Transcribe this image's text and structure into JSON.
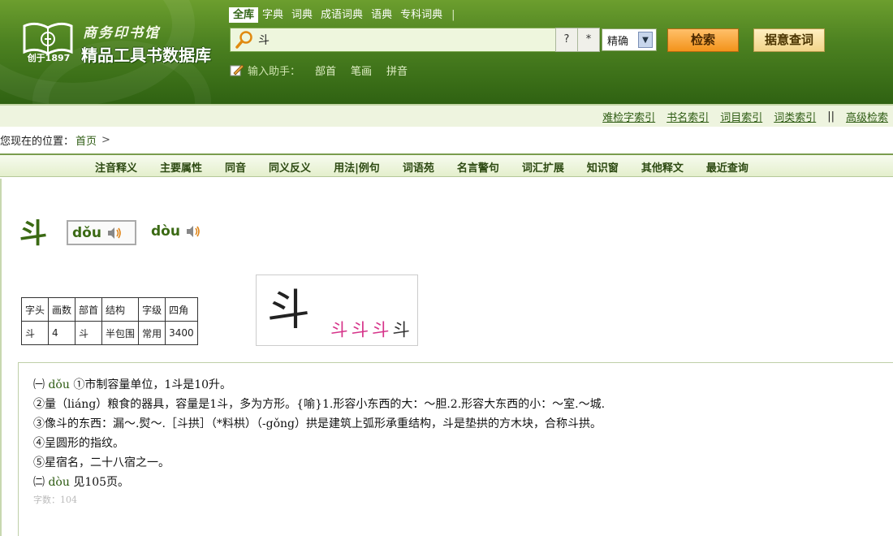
{
  "header": {
    "logo_year": "创于1897",
    "logo_publisher": "商务印书馆",
    "logo_title": "精品工具书数据库"
  },
  "db_tabs": [
    "全库",
    "字典",
    "词典",
    "成语词典",
    "语典",
    "专科词典"
  ],
  "search": {
    "value": "斗",
    "wildcard_q": "?",
    "wildcard_star": "*",
    "mode": "精确",
    "search_label": "检索",
    "meaning_label": "据意查词"
  },
  "assist": {
    "label": "输入助手：",
    "links": [
      "部首",
      "笔画",
      "拼音"
    ]
  },
  "index_links": [
    "难检字索引",
    "书名索引",
    "词目索引",
    "词类索引",
    "高级检索"
  ],
  "breadcrumb": {
    "label": "您现在的位置：",
    "home": "首页",
    "sep": ">"
  },
  "section_nav": [
    "注音释义",
    "主要属性",
    "同音",
    "同义反义",
    "用法|例句",
    "词语苑",
    "名言警句",
    "词汇扩展",
    "知识窗",
    "其他释文",
    "最近查询"
  ],
  "entry": {
    "character": "斗",
    "pinyin1": "dǒu",
    "pinyin2": "dòu",
    "table_headers": [
      "字头",
      "画数",
      "部首",
      "结构",
      "字级",
      "四角"
    ],
    "table_values": [
      "斗",
      "4",
      "斗",
      "半包围",
      "常用",
      "3400"
    ],
    "stroke_small": [
      "斗",
      "斗",
      "斗",
      "斗"
    ]
  },
  "definitions": {
    "l1a": "㈠ ",
    "l1b": "dǒu",
    "l1c": " ①市制容量单位，1斗是10升。",
    "l2": "②量（liáng）粮食的器具，容量是1斗，多为方形。{喻}1.形容小东西的大：～胆.2.形容大东西的小：～室.～城.",
    "l3": "③像斗的东西：漏～.熨～.［斗拱］（*料栱）（-gǒng）拱是建筑上弧形承重结构，斗是垫拱的方木块，合称斗拱。",
    "l4": "④呈圆形的指纹。",
    "l5": "⑤星宿名，二十八宿之一。",
    "l6a": "㈡ ",
    "l6b": "dòu",
    "l6c": " 见105页。",
    "l7": "字数：104"
  }
}
